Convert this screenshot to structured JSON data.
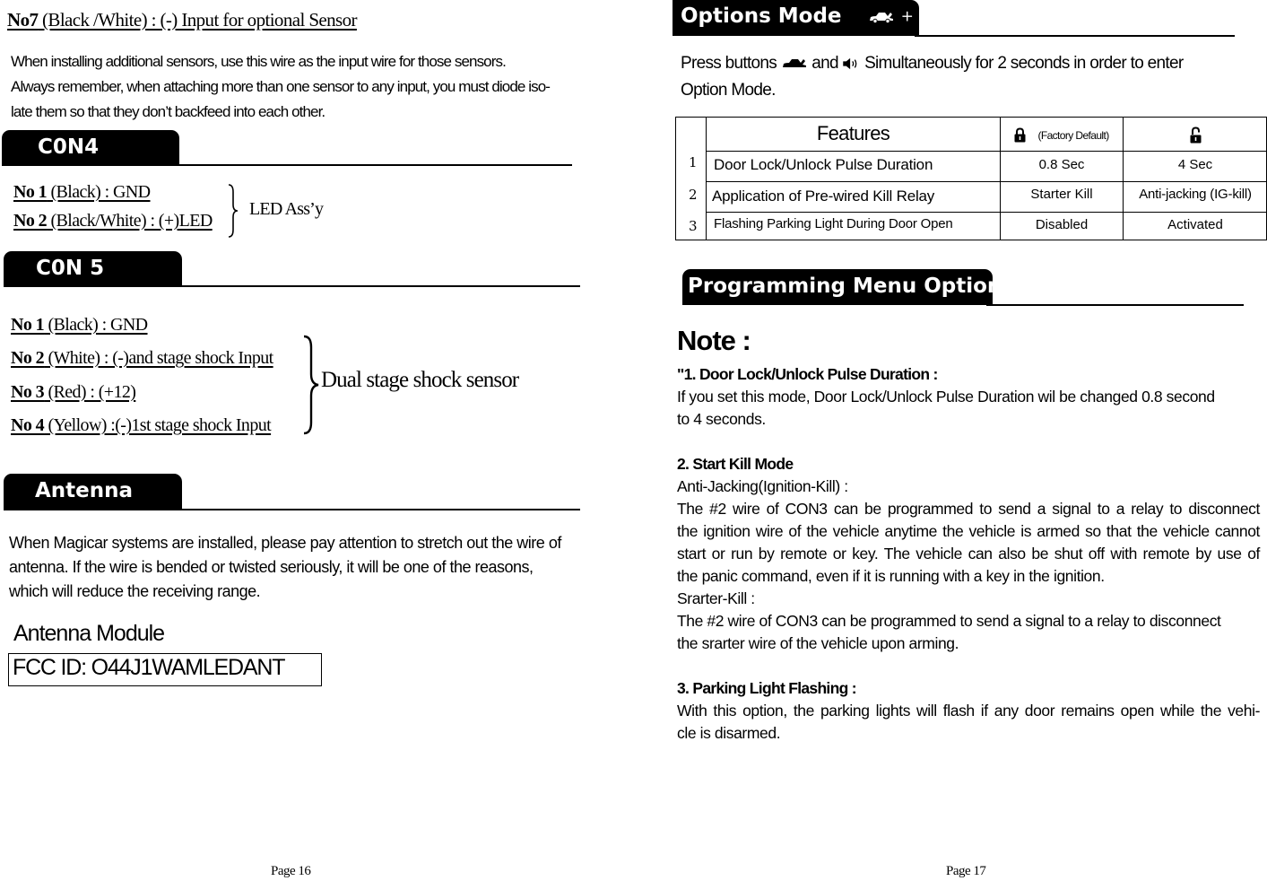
{
  "left_page": {
    "no7": {
      "num": "No7",
      "desc": " (Black /White) : (-) Input for optional Sensor",
      "lines": [
        "When installing additional sensors, use this wire as the input wire for those sensors.",
        "Always remember, when attaching more than one sensor to any input, you must diode iso-",
        "late them so that they don’t backfeed into each other."
      ]
    },
    "con4": {
      "title": "C0N4",
      "wires": [
        {
          "num": "No 1",
          "desc": " (Black) : GND"
        },
        {
          "num": "No 2",
          "desc": " (Black/White) : (+)LED"
        }
      ],
      "group_label": "LED Ass’y"
    },
    "con5": {
      "title": "C0N 5",
      "wires": [
        {
          "num": "No 1",
          "desc": " (Black) : GND"
        },
        {
          "num": "No 2",
          "desc": " (White) : (-)and stage shock Input"
        },
        {
          "num": "No 3",
          "desc": " (Red) : (+12)"
        },
        {
          "num": "No 4",
          "desc": " (Yellow) :(-)1st stage shock Input"
        }
      ],
      "group_label": "Dual stage shock sensor"
    },
    "antenna": {
      "title": "Antenna",
      "lines": [
        "When Magicar systems are installed, please pay attention to stretch out the wire of",
        "antenna. If the wire is bended or twisted seriously, it will be one of the reasons,",
        "which will reduce the receiving range."
      ],
      "module_label": "Antenna  Module",
      "fcc_id": "FCC ID: O44J1WAMLEDANT"
    },
    "page_number": "Page 16"
  },
  "right_page": {
    "options_mode": {
      "title": "Options Mode",
      "title_icons": [
        "car-trunk-icon",
        "plus",
        "speaker-icon"
      ],
      "plus": "+",
      "intro_part1": "Press buttons",
      "intro_and": "and",
      "intro_part2": "Simultaneously for 2 seconds in order to enter",
      "intro_line2": "Option Mode."
    },
    "table": {
      "header_features": "Features",
      "header_default": "(Factory Default)",
      "header_default_icon": "lock-closed-icon",
      "header_alt_icon": "lock-open-icon",
      "rows": [
        {
          "num": "1",
          "feature": "Door Lock/Unlock Pulse Duration",
          "default": "0.8 Sec",
          "alt": "4 Sec"
        },
        {
          "num": "2",
          "feature": "Application of Pre-wired Kill Relay",
          "default": "Starter Kill",
          "alt": "Anti-jacking (IG-kill)"
        },
        {
          "num": "3",
          "feature": "Flashing Parking Light During Door Open",
          "default": "Disabled",
          "alt": "Activated"
        }
      ]
    },
    "programming": {
      "title": "Programming Menu Option",
      "note_heading": "Note :",
      "sections": [
        {
          "heading": "\"1. Door Lock/Unlock Pulse Duration :",
          "lines": [
            "If you set this mode, Door Lock/Unlock Pulse Duration wil be changed 0.8 second",
            "to 4 seconds."
          ]
        },
        {
          "heading": "2. Start Kill Mode",
          "lines": [
            "Anti-Jacking(Ignition-Kill) :",
            "The #2 wire of CON3 can be programmed to send a signal to a relay to disconnect",
            "the ignition wire of the vehicle anytime the vehicle is armed so that the vehicle cannot",
            "start or run by remote or key. The vehicle can also be shut off with remote by use of",
            "the panic command, even if it is running with a key in the ignition.",
            "Srarter-Kill :",
            "The #2 wire of CON3 can be programmed to send a signal to a relay to disconnect",
            "the srarter  wire of the vehicle upon arming."
          ]
        },
        {
          "heading": "3. Parking Light Flashing :",
          "lines": [
            "With this option, the parking lights will flash if any door remains open while the vehi-",
            "cle is disarmed."
          ]
        }
      ]
    },
    "page_number": "Page 17"
  }
}
